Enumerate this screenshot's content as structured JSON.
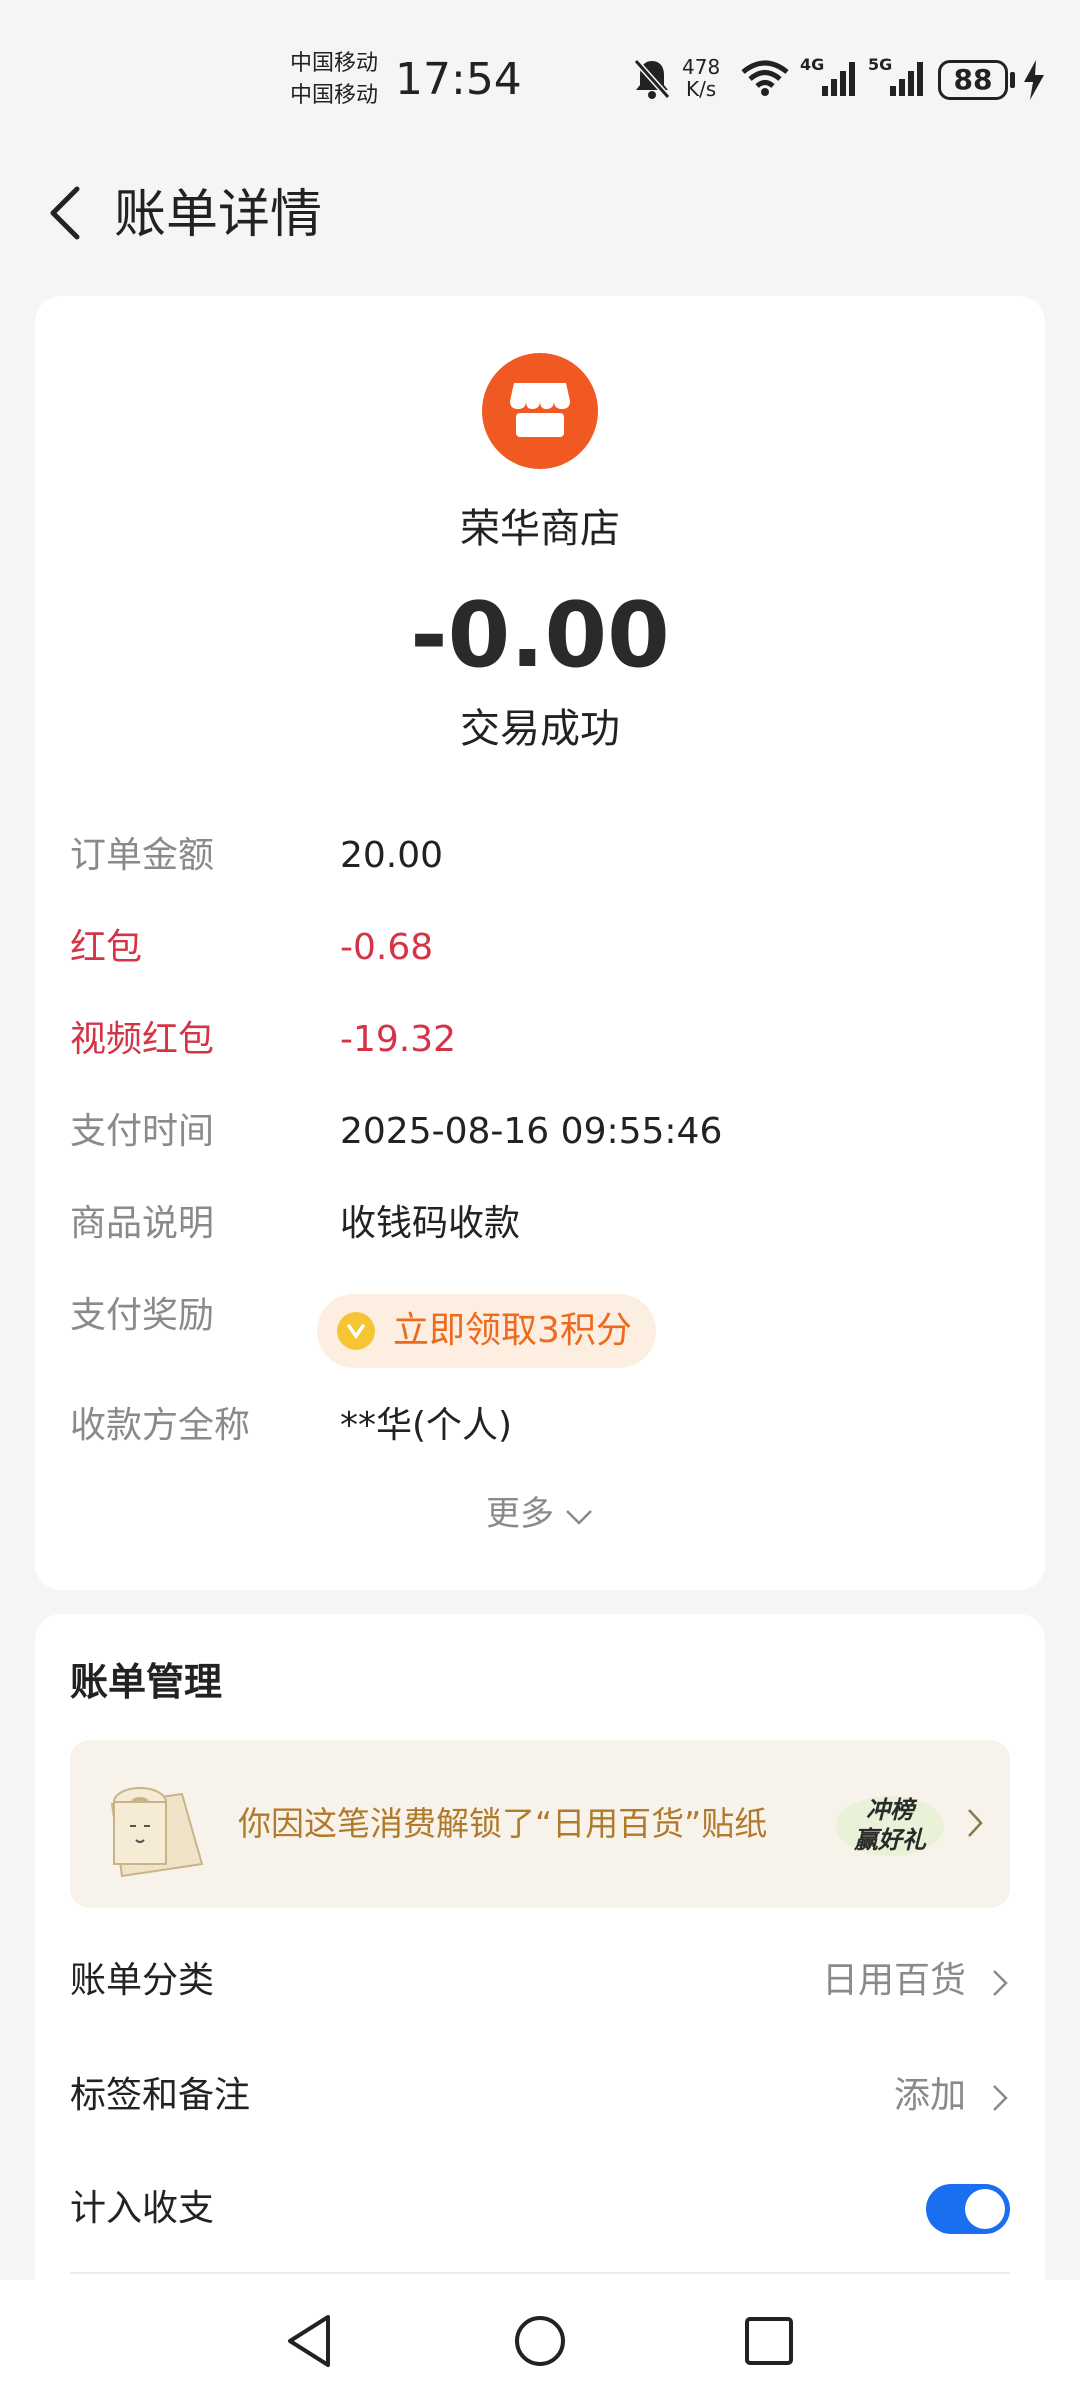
{
  "status_bar": {
    "carrier_1": "中国移动",
    "carrier_2": "中国移动",
    "time": "17:54",
    "speed_value": "478",
    "speed_unit": "K/s",
    "network_1": "4G",
    "network_2": "5G",
    "battery": "88"
  },
  "header": {
    "title": "账单详情"
  },
  "merchant": {
    "name": "荣华商店",
    "amount": "-0.00",
    "status": "交易成功",
    "accent_color": "#f05a22"
  },
  "details": [
    {
      "label": "订单金额",
      "value": "20.00"
    },
    {
      "label": "红包",
      "value": "-0.68"
    },
    {
      "label": "视频红包",
      "value": "-19.32"
    },
    {
      "label": "支付时间",
      "value": "2025-08-16 09:55:46"
    },
    {
      "label": "商品说明",
      "value": "收钱码收款"
    },
    {
      "label": "支付奖励",
      "value": ""
    },
    {
      "label": "收款方全称",
      "value": "**华(个人)"
    }
  ],
  "reward": {
    "text": "立即领取3积分"
  },
  "more": {
    "label": "更多"
  },
  "manage": {
    "title": "账单管理",
    "banner_text": "你因这笔消费解锁了“日用百货”贴纸",
    "banner_badge_line1": "冲榜",
    "banner_badge_line2": "赢好礼",
    "category_label": "账单分类",
    "category_value": "日用百货",
    "tags_label": "标签和备注",
    "tags_value": "添加",
    "include_label": "计入收支",
    "include_on": true
  },
  "colors": {
    "red": "#d53447",
    "toggle_blue": "#1a6ef0",
    "banner_text": "#b07a2c",
    "reward_text": "#ee6a1d"
  }
}
